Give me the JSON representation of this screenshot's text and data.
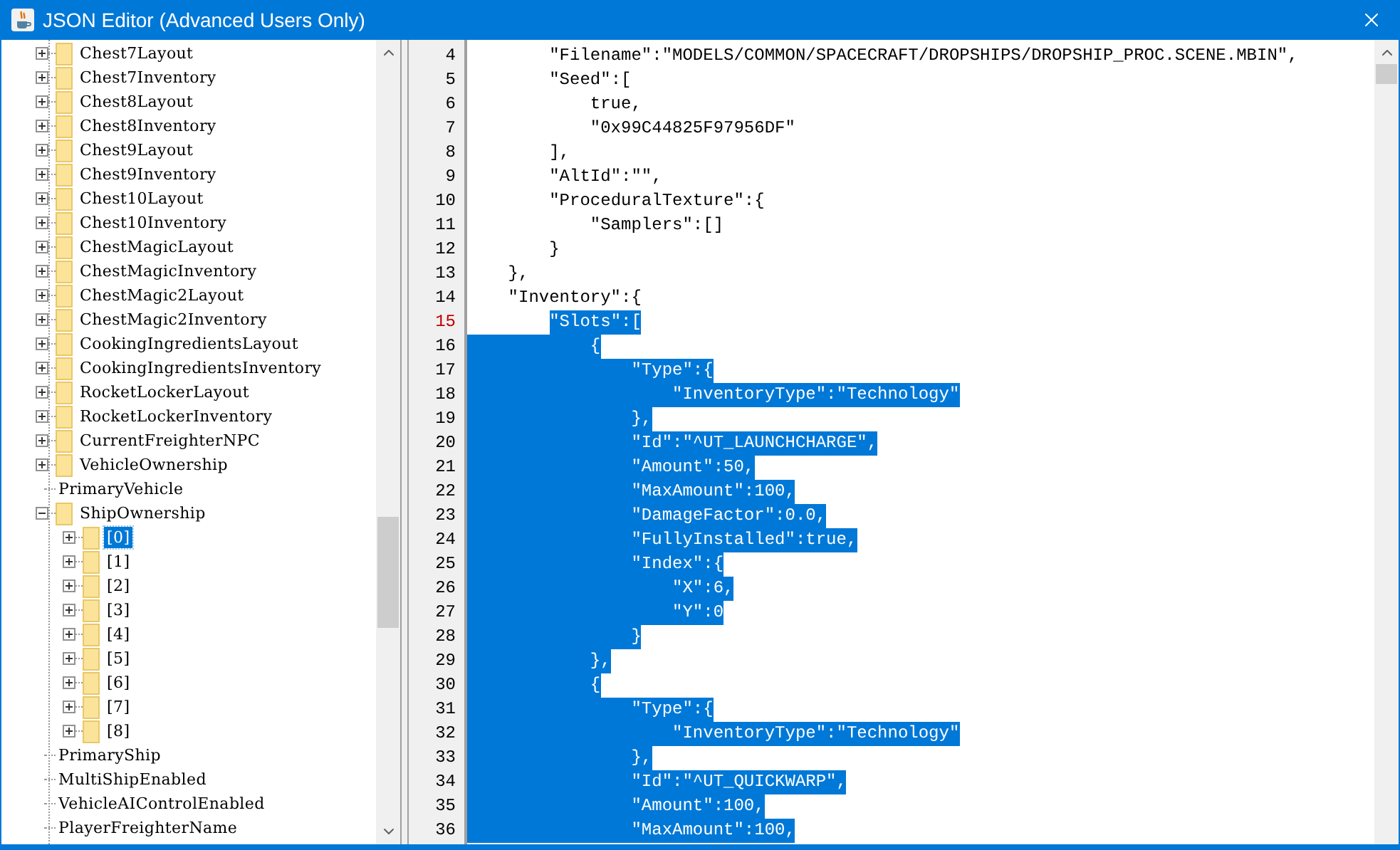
{
  "window": {
    "title": "JSON Editor (Advanced Users Only)"
  },
  "tree": [
    {
      "label": "Chest7Layout",
      "kind": "folder",
      "expanded": false,
      "selected": false
    },
    {
      "label": "Chest7Inventory",
      "kind": "folder",
      "expanded": false,
      "selected": false
    },
    {
      "label": "Chest8Layout",
      "kind": "folder",
      "expanded": false,
      "selected": false
    },
    {
      "label": "Chest8Inventory",
      "kind": "folder",
      "expanded": false,
      "selected": false
    },
    {
      "label": "Chest9Layout",
      "kind": "folder",
      "expanded": false,
      "selected": false
    },
    {
      "label": "Chest9Inventory",
      "kind": "folder",
      "expanded": false,
      "selected": false
    },
    {
      "label": "Chest10Layout",
      "kind": "folder",
      "expanded": false,
      "selected": false
    },
    {
      "label": "Chest10Inventory",
      "kind": "folder",
      "expanded": false,
      "selected": false
    },
    {
      "label": "ChestMagicLayout",
      "kind": "folder",
      "expanded": false,
      "selected": false
    },
    {
      "label": "ChestMagicInventory",
      "kind": "folder",
      "expanded": false,
      "selected": false
    },
    {
      "label": "ChestMagic2Layout",
      "kind": "folder",
      "expanded": false,
      "selected": false
    },
    {
      "label": "ChestMagic2Inventory",
      "kind": "folder",
      "expanded": false,
      "selected": false
    },
    {
      "label": "CookingIngredientsLayout",
      "kind": "folder",
      "expanded": false,
      "selected": false
    },
    {
      "label": "CookingIngredientsInventory",
      "kind": "folder",
      "expanded": false,
      "selected": false
    },
    {
      "label": "RocketLockerLayout",
      "kind": "folder",
      "expanded": false,
      "selected": false
    },
    {
      "label": "RocketLockerInventory",
      "kind": "folder",
      "expanded": false,
      "selected": false
    },
    {
      "label": "CurrentFreighterNPC",
      "kind": "folder",
      "expanded": false,
      "selected": false
    },
    {
      "label": "VehicleOwnership",
      "kind": "folder",
      "expanded": false,
      "selected": false
    },
    {
      "label": "PrimaryVehicle",
      "kind": "value",
      "selected": false
    },
    {
      "label": "ShipOwnership",
      "kind": "folder",
      "expanded": true,
      "selected": false,
      "children": [
        {
          "label": "[0]",
          "kind": "folder",
          "expanded": false,
          "selected": true
        },
        {
          "label": "[1]",
          "kind": "folder",
          "expanded": false,
          "selected": false
        },
        {
          "label": "[2]",
          "kind": "folder",
          "expanded": false,
          "selected": false
        },
        {
          "label": "[3]",
          "kind": "folder",
          "expanded": false,
          "selected": false
        },
        {
          "label": "[4]",
          "kind": "folder",
          "expanded": false,
          "selected": false
        },
        {
          "label": "[5]",
          "kind": "folder",
          "expanded": false,
          "selected": false
        },
        {
          "label": "[6]",
          "kind": "folder",
          "expanded": false,
          "selected": false
        },
        {
          "label": "[7]",
          "kind": "folder",
          "expanded": false,
          "selected": false
        },
        {
          "label": "[8]",
          "kind": "folder",
          "expanded": false,
          "selected": false
        }
      ]
    },
    {
      "label": "PrimaryShip",
      "kind": "value",
      "selected": false
    },
    {
      "label": "MultiShipEnabled",
      "kind": "value",
      "selected": false
    },
    {
      "label": "VehicleAIControlEnabled",
      "kind": "value",
      "selected": false
    },
    {
      "label": "PlayerFreighterName",
      "kind": "value",
      "selected": false
    }
  ],
  "editor": {
    "lines": [
      {
        "number": "4",
        "text": "        \"Filename\":\"MODELS/COMMON/SPACECRAFT/DROPSHIPS/DROPSHIP_PROC.SCENE.MBIN\",",
        "selected": false,
        "current": false
      },
      {
        "number": "5",
        "text": "        \"Seed\":[",
        "selected": false,
        "current": false
      },
      {
        "number": "6",
        "text": "            true,",
        "selected": false,
        "current": false
      },
      {
        "number": "7",
        "text": "            \"0x99C44825F97956DF\"",
        "selected": false,
        "current": false
      },
      {
        "number": "8",
        "text": "        ],",
        "selected": false,
        "current": false
      },
      {
        "number": "9",
        "text": "        \"AltId\":\"\",",
        "selected": false,
        "current": false
      },
      {
        "number": "10",
        "text": "        \"ProceduralTexture\":{",
        "selected": false,
        "current": false
      },
      {
        "number": "11",
        "text": "            \"Samplers\":[]",
        "selected": false,
        "current": false
      },
      {
        "number": "12",
        "text": "        }",
        "selected": false,
        "current": false
      },
      {
        "number": "13",
        "text": "    },",
        "selected": false,
        "current": false
      },
      {
        "number": "14",
        "text": "    \"Inventory\":{",
        "selected": false,
        "current": false
      },
      {
        "number": "15",
        "text": "        \"Slots\":[",
        "selected": true,
        "current": true
      },
      {
        "number": "16",
        "text": "            {",
        "selected": true,
        "current": false
      },
      {
        "number": "17",
        "text": "                \"Type\":{",
        "selected": true,
        "current": false
      },
      {
        "number": "18",
        "text": "                    \"InventoryType\":\"Technology\"",
        "selected": true,
        "current": false
      },
      {
        "number": "19",
        "text": "                },",
        "selected": true,
        "current": false
      },
      {
        "number": "20",
        "text": "                \"Id\":\"^UT_LAUNCHCHARGE\",",
        "selected": true,
        "current": false
      },
      {
        "number": "21",
        "text": "                \"Amount\":50,",
        "selected": true,
        "current": false
      },
      {
        "number": "22",
        "text": "                \"MaxAmount\":100,",
        "selected": true,
        "current": false
      },
      {
        "number": "23",
        "text": "                \"DamageFactor\":0.0,",
        "selected": true,
        "current": false
      },
      {
        "number": "24",
        "text": "                \"FullyInstalled\":true,",
        "selected": true,
        "current": false
      },
      {
        "number": "25",
        "text": "                \"Index\":{",
        "selected": true,
        "current": false
      },
      {
        "number": "26",
        "text": "                    \"X\":6,",
        "selected": true,
        "current": false
      },
      {
        "number": "27",
        "text": "                    \"Y\":0",
        "selected": true,
        "current": false
      },
      {
        "number": "28",
        "text": "                }",
        "selected": true,
        "current": false
      },
      {
        "number": "29",
        "text": "            },",
        "selected": true,
        "current": false
      },
      {
        "number": "30",
        "text": "            {",
        "selected": true,
        "current": false
      },
      {
        "number": "31",
        "text": "                \"Type\":{",
        "selected": true,
        "current": false
      },
      {
        "number": "32",
        "text": "                    \"InventoryType\":\"Technology\"",
        "selected": true,
        "current": false
      },
      {
        "number": "33",
        "text": "                },",
        "selected": true,
        "current": false
      },
      {
        "number": "34",
        "text": "                \"Id\":\"^UT_QUICKWARP\",",
        "selected": true,
        "current": false
      },
      {
        "number": "35",
        "text": "                \"Amount\":100,",
        "selected": true,
        "current": false
      },
      {
        "number": "36",
        "text": "                \"MaxAmount\":100,",
        "selected": true,
        "current": false
      }
    ]
  }
}
